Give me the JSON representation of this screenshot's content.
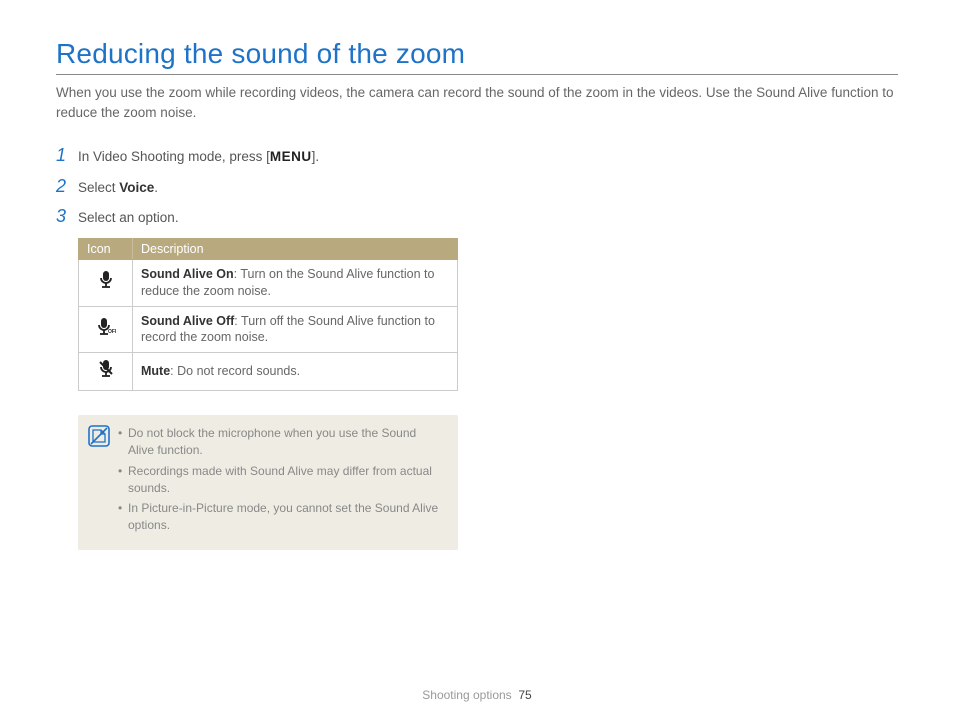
{
  "title": "Reducing the sound of the zoom",
  "intro": "When you use the zoom while recording videos, the camera can record the sound of the zoom in the videos. Use the Sound Alive function to reduce the zoom noise.",
  "steps": [
    {
      "num": "1",
      "pre": "In Video Shooting mode, press [",
      "menu": "MENU",
      "post": "]."
    },
    {
      "num": "2",
      "pre": "Select ",
      "bold": "Voice",
      "post": "."
    },
    {
      "num": "3",
      "pre": "Select an option.",
      "bold": "",
      "post": ""
    }
  ],
  "table": {
    "headers": [
      "Icon",
      "Description"
    ],
    "rows": [
      {
        "icon": "mic-on",
        "bold": "Sound Alive On",
        "rest": ": Turn on the Sound Alive function to reduce the zoom noise."
      },
      {
        "icon": "mic-off",
        "bold": "Sound Alive Off",
        "rest": ": Turn off the Sound Alive function to record the zoom noise."
      },
      {
        "icon": "mic-mute",
        "bold": "Mute",
        "rest": ": Do not record sounds."
      }
    ]
  },
  "notes": [
    "Do not block the microphone when you use the Sound Alive function.",
    "Recordings made with Sound Alive may differ from actual sounds.",
    "In Picture-in-Picture mode, you cannot set the Sound Alive options."
  ],
  "footer": {
    "section": "Shooting options",
    "page": "75"
  }
}
